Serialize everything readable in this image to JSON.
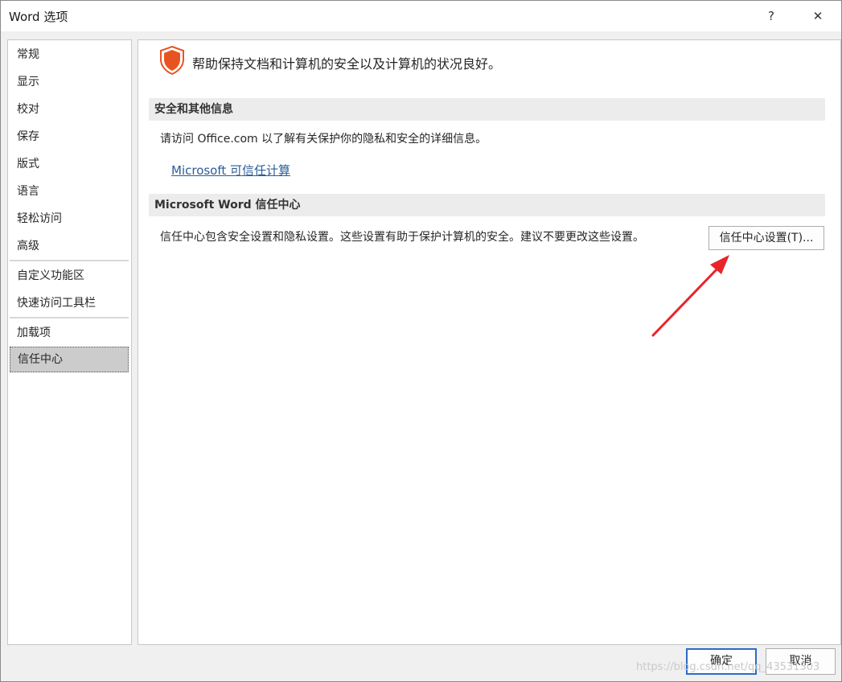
{
  "window": {
    "title": "Word 选项",
    "help_label": "?",
    "close_label": "✕"
  },
  "sidebar": {
    "items": [
      {
        "label": "常规"
      },
      {
        "label": "显示"
      },
      {
        "label": "校对"
      },
      {
        "label": "保存"
      },
      {
        "label": "版式"
      },
      {
        "label": "语言"
      },
      {
        "label": "轻松访问"
      },
      {
        "label": "高级"
      },
      {
        "label": "自定义功能区"
      },
      {
        "label": "快速访问工具栏"
      },
      {
        "label": "加载项"
      },
      {
        "label": "信任中心"
      }
    ],
    "selected": "信任中心"
  },
  "main": {
    "intro": "帮助保持文档和计算机的安全以及计算机的状况良好。",
    "security_section": {
      "heading": "安全和其他信息",
      "text": "请访问 Office.com 以了解有关保护你的隐私和安全的详细信息。",
      "link": "Microsoft 可信任计算"
    },
    "trust_section": {
      "heading": "Microsoft Word 信任中心",
      "text": "信任中心包含安全设置和隐私设置。这些设置有助于保护计算机的安全。建议不要更改这些设置。",
      "button": "信任中心设置(T)..."
    }
  },
  "footer": {
    "ok": "确定",
    "cancel": "取消",
    "watermark": "https://blog.csdn.net/qq_43531303"
  },
  "colors": {
    "accent": "#2b6cc4",
    "shield": "#e8541f",
    "link": "#2a5c99",
    "arrow": "#e8242a"
  },
  "icons": {
    "shield": "shield-icon",
    "close": "close-icon",
    "help": "help-icon"
  }
}
